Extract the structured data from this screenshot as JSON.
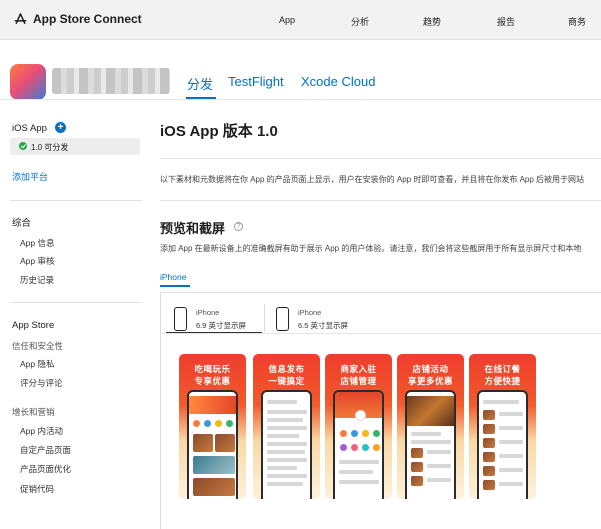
{
  "topbar": {
    "brand": "App Store Connect",
    "nav": [
      "App",
      "分析",
      "趋势",
      "报告",
      "商务"
    ]
  },
  "app_header": {
    "tabs": [
      "分发",
      "TestFlight",
      "Xcode Cloud"
    ],
    "active_tab": "分发"
  },
  "sidebar": {
    "platform_title": "iOS App",
    "version_status": "1.0 可分发",
    "add_platform": "添加平台",
    "general": {
      "title": "综合",
      "items": [
        "App 信息",
        "App 审核",
        "历史记录"
      ]
    },
    "app_store": {
      "title": "App Store",
      "trust_group": "信任和安全性",
      "trust_items": [
        "App 隐私",
        "评分与评论"
      ],
      "growth_group": "增长和营销",
      "growth_items": [
        "App 内活动",
        "自定产品页面",
        "产品页面优化",
        "促销代码"
      ]
    }
  },
  "main": {
    "title": "iOS App 版本 1.0",
    "description": "以下素材和元数据将在你 App 的产品页面上显示，用户在安装你的 App 时即可查看，并且将在你发布 App 后被用于网站",
    "preview_title": "预览和截屏",
    "preview_desc": "添加 App 在最新设备上的准确截屏有助于展示 App 的用户体验。请注意，我们会将这些截屏用于所有显示屏尺寸和本地",
    "device_tab": "iPhone",
    "sizes": [
      {
        "name": "iPhone",
        "desc": "6.9 英寸显示屏",
        "selected": true
      },
      {
        "name": "iPhone",
        "desc": "6.5 英寸显示屏",
        "selected": false
      }
    ],
    "screenshots": [
      {
        "line1": "吃喝玩乐",
        "line2": "专享优惠"
      },
      {
        "line1": "信息发布",
        "line2": "一键搞定"
      },
      {
        "line1": "商家入驻",
        "line2": "店铺管理"
      },
      {
        "line1": "店铺活动",
        "line2": "享更多优惠"
      },
      {
        "line1": "在线订餐",
        "line2": "方便快捷"
      }
    ]
  },
  "colors": {
    "accent": "#0070c9",
    "status_green": "#29a745",
    "screenshot_red": "#ef3d2d"
  }
}
